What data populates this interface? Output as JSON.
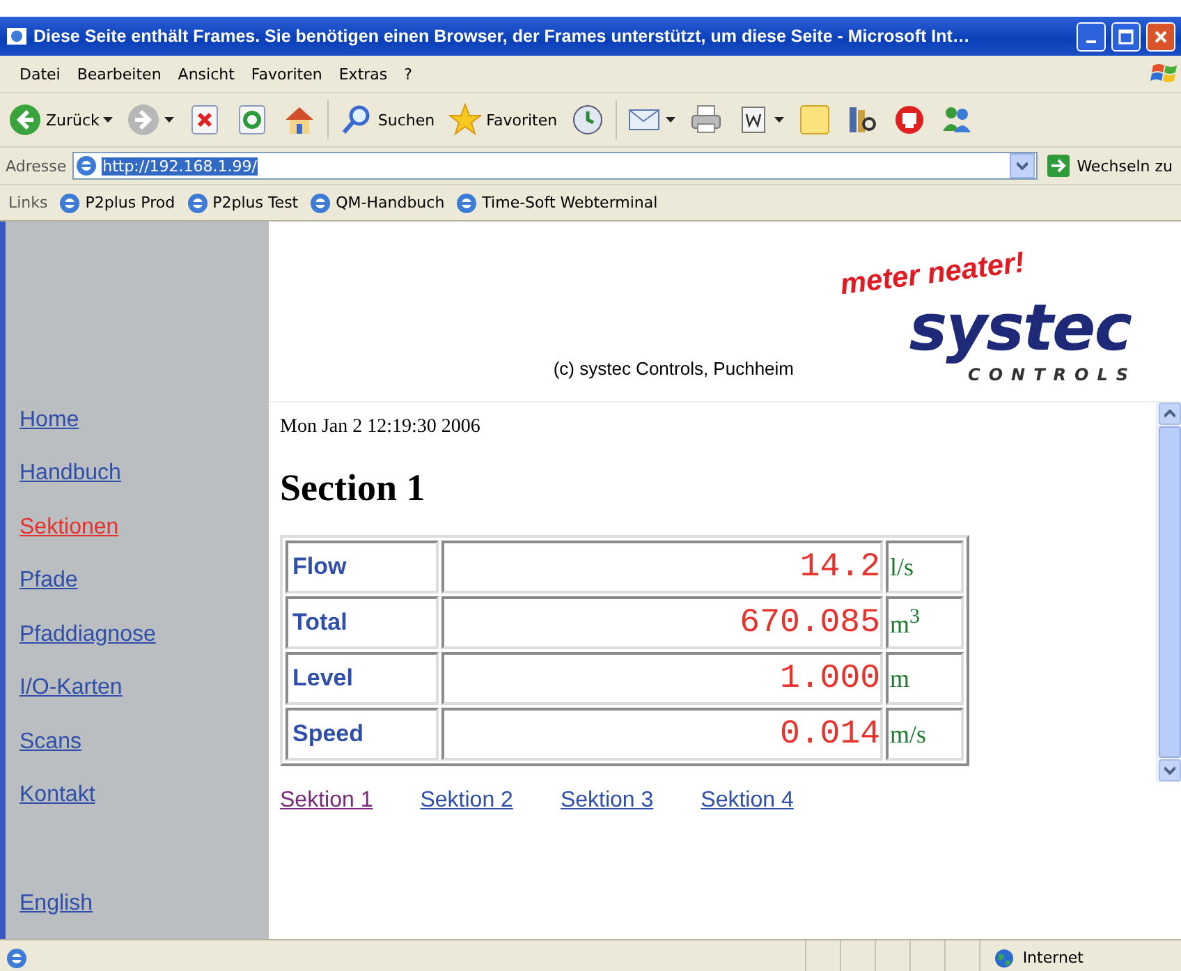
{
  "window": {
    "title": "Diese Seite enthält Frames. Sie benötigen einen Browser, der Frames unterstützt, um diese Seite - Microsoft Int…"
  },
  "menu": [
    "Datei",
    "Bearbeiten",
    "Ansicht",
    "Favoriten",
    "Extras",
    "?"
  ],
  "toolbar": [
    {
      "kind": "back",
      "label": "Zurück",
      "dropdown": true
    },
    {
      "kind": "forward",
      "dropdown": true
    },
    {
      "kind": "stop"
    },
    {
      "kind": "refresh"
    },
    {
      "kind": "home"
    },
    {
      "kind": "search",
      "label": "Suchen"
    },
    {
      "kind": "favorites",
      "label": "Favoriten"
    },
    {
      "kind": "history"
    },
    {
      "kind": "mail",
      "dropdown": true
    },
    {
      "kind": "print"
    },
    {
      "kind": "edit",
      "dropdown": true
    },
    {
      "kind": "notes"
    },
    {
      "kind": "research"
    },
    {
      "kind": "messenger"
    },
    {
      "kind": "people"
    }
  ],
  "address": {
    "label": "Adresse",
    "value": "http://192.168.1.99/",
    "go": "Wechseln zu"
  },
  "links": {
    "label": "Links",
    "items": [
      "P2plus Prod",
      "P2plus Test",
      "QM-Handbuch",
      "Time-Soft Webterminal"
    ]
  },
  "sidebar": {
    "items": [
      {
        "label": "Home",
        "selected": false
      },
      {
        "label": "Handbuch",
        "selected": false
      },
      {
        "label": "Sektionen",
        "selected": true
      },
      {
        "label": "Pfade",
        "selected": false
      },
      {
        "label": "Pfaddiagnose",
        "selected": false
      },
      {
        "label": "I/O-Karten",
        "selected": false
      },
      {
        "label": "Scans",
        "selected": false
      },
      {
        "label": "Kontakt",
        "selected": false
      }
    ],
    "language": "English"
  },
  "header": {
    "slogan": "meter neater!",
    "logo": "systec",
    "logo_sub": "CONTROLS",
    "copyright": "(c) systec Controls, Puchheim"
  },
  "content": {
    "timestamp": "Mon Jan 2 12:19:30 2006",
    "heading": "Section 1",
    "rows": [
      {
        "label": "Flow",
        "value": "14.2",
        "unit": "l/s"
      },
      {
        "label": "Total",
        "value": "670.085",
        "unit": "m$^{3}$"
      },
      {
        "label": "Level",
        "value": "1.000",
        "unit": "m"
      },
      {
        "label": "Speed",
        "value": "0.014",
        "unit": "m/s"
      }
    ],
    "section_links": [
      {
        "label": "Sektion 1",
        "visited": true
      },
      {
        "label": "Sektion 2",
        "visited": false
      },
      {
        "label": "Sektion 3",
        "visited": false
      },
      {
        "label": "Sektion 4",
        "visited": false
      }
    ]
  },
  "status_bar": {
    "zone": "Internet"
  }
}
